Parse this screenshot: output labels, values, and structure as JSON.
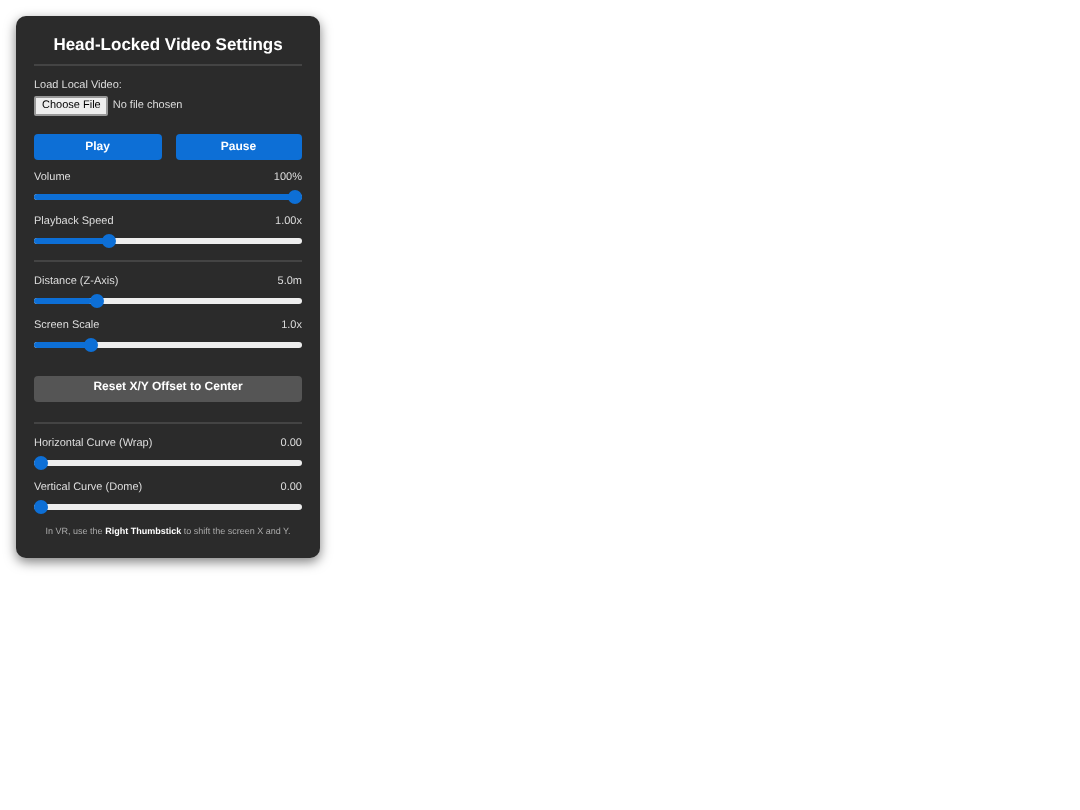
{
  "panel": {
    "title": "Head-Locked Video Settings"
  },
  "file_input": {
    "label": "Load Local Video:",
    "button": "Choose File",
    "status": "No file chosen"
  },
  "buttons": [
    "Play",
    "Pause"
  ],
  "groups": [
    {
      "sliders": [
        {
          "label": "Volume",
          "reading": "100%",
          "level": 1.0
        },
        {
          "label": "Playback Speed",
          "reading": "1.00x",
          "level": 0.27
        }
      ]
    },
    {
      "sliders": [
        {
          "label": "Distance (Z-Axis)",
          "reading": "5.0m",
          "level": 0.22
        },
        {
          "label": "Screen Scale",
          "reading": "1.0x",
          "level": 0.2
        }
      ],
      "button": "Reset X/Y Offset to Center"
    },
    {
      "sliders": [
        {
          "label": "Horizontal Curve (Wrap)",
          "reading": "0.00",
          "level": 0.0
        },
        {
          "label": "Vertical Curve (Dome)",
          "reading": "0.00",
          "level": 0.0
        }
      ]
    }
  ],
  "footnote": "In VR, use the **Right Thumbstick** to shift the screen X and Y."
}
